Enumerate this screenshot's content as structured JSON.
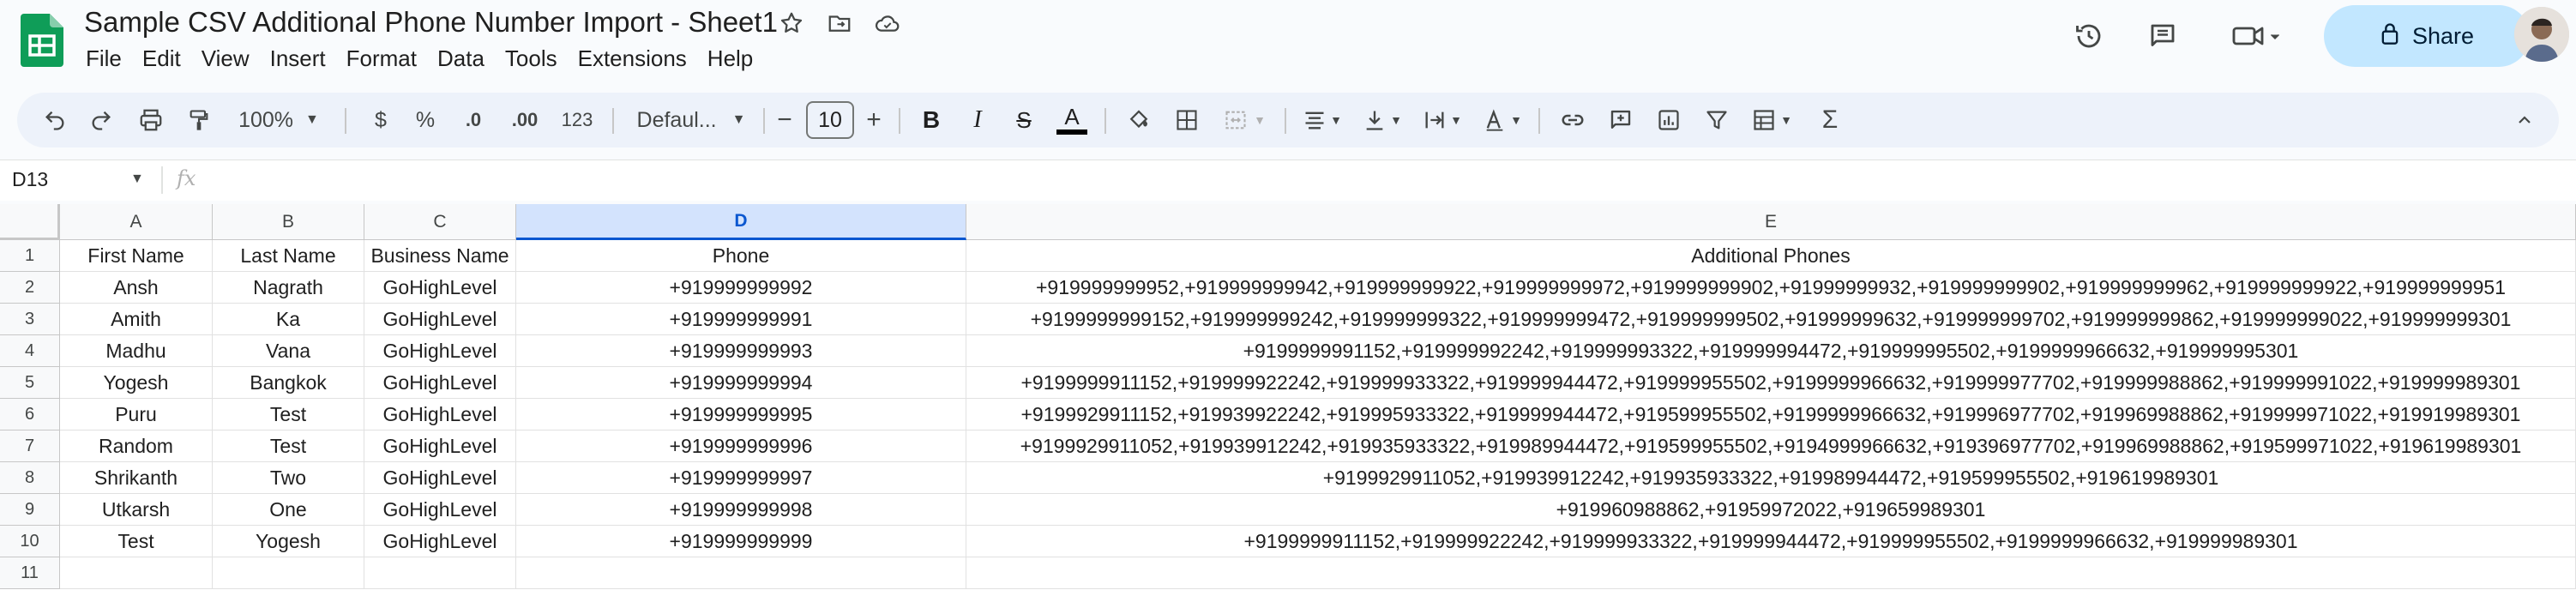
{
  "document": {
    "title": "Sample CSV Additional Phone Number Import - Sheet1"
  },
  "menu": [
    "File",
    "Edit",
    "View",
    "Insert",
    "Format",
    "Data",
    "Tools",
    "Extensions",
    "Help"
  ],
  "header": {
    "share_label": "Share",
    "icons": [
      "version-history-icon",
      "comment-icon",
      "meet-icon",
      "lock-icon"
    ]
  },
  "toolbar": {
    "zoom": "100%",
    "currency": "$",
    "percent": "%",
    "decrease_decimal": ".0",
    "increase_decimal": ".00",
    "number_format": "123",
    "font": "Defaul...",
    "font_size": "10"
  },
  "formula_bar": {
    "name_box": "D13",
    "fx": "fx",
    "value": ""
  },
  "sheet": {
    "column_headers": [
      "A",
      "B",
      "C",
      "D",
      "E"
    ],
    "selected_column": "D",
    "row_numbers": [
      "1",
      "2",
      "3",
      "4",
      "5",
      "6",
      "7",
      "8",
      "9",
      "10",
      "11"
    ],
    "rows": [
      [
        "First Name",
        "Last Name",
        "Business Name",
        "Phone",
        "Additional Phones"
      ],
      [
        "Ansh",
        "Nagrath",
        "GoHighLevel",
        "+919999999992",
        "+919999999952,+919999999942,+919999999922,+919999999972,+919999999902,+91999999932,+919999999902,+919999999962,+919999999922,+919999999951"
      ],
      [
        "Amith",
        "Ka",
        "GoHighLevel",
        "+919999999991",
        "+9199999999152,+919999999242,+919999999322,+919999999472,+919999999502,+91999999632,+919999999702,+919999999862,+919999999022,+919999999301"
      ],
      [
        "Madhu",
        "Vana",
        "GoHighLevel",
        "+919999999993",
        "+9199999991152,+919999992242,+919999993322,+919999994472,+919999995502,+9199999966632,+919999995301"
      ],
      [
        "Yogesh",
        "Bangkok",
        "GoHighLevel",
        "+919999999994",
        "+9199999911152,+919999922242,+919999933322,+919999944472,+919999955502,+9199999966632,+919999977702,+919999988862,+919999991022,+919999989301"
      ],
      [
        "Puru",
        "Test",
        "GoHighLevel",
        "+919999999995",
        "+9199929911152,+919939922242,+919995933322,+919999944472,+919599955502,+9199999966632,+919996977702,+919969988862,+919999971022,+919919989301"
      ],
      [
        "Random",
        "Test",
        "GoHighLevel",
        "+919999999996",
        "+9199929911052,+919939912242,+919935933322,+919989944472,+919599955502,+9194999966632,+919396977702,+919969988862,+919599971022,+919619989301"
      ],
      [
        "Shrikanth",
        "Two",
        "GoHighLevel",
        "+919999999997",
        "+9199929911052,+919939912242,+919935933322,+919989944472,+919599955502,+919619989301"
      ],
      [
        "Utkarsh",
        "One",
        "GoHighLevel",
        "+919999999998",
        "+919960988862,+91959972022,+919659989301"
      ],
      [
        "Test",
        "Yogesh",
        "GoHighLevel",
        "+919999999999",
        "+9199999911152,+919999922242,+919999933322,+919999944472,+919999955502,+9199999966632,+919999989301"
      ],
      [
        "",
        "",
        "",
        "",
        ""
      ]
    ]
  }
}
